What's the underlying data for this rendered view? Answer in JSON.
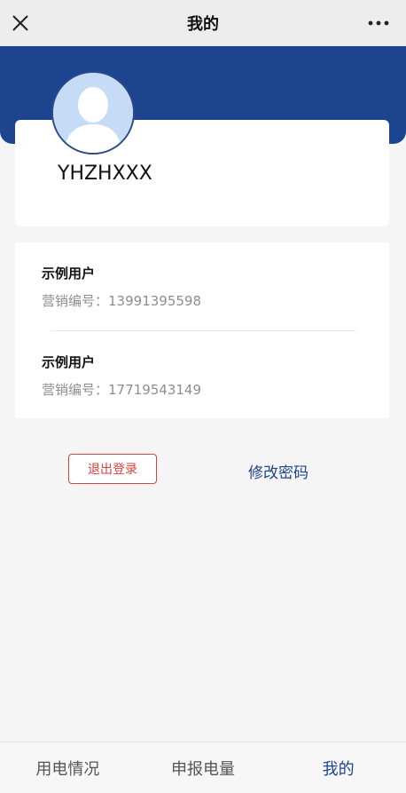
{
  "header": {
    "title": "我的",
    "close_icon": "close-icon",
    "more_icon": "more-icon"
  },
  "profile": {
    "username": "YHZHXXX",
    "avatar_icon": "user-avatar-icon"
  },
  "accounts": [
    {
      "name": "示例用户",
      "number_label": "营销编号：",
      "number": "13991395598"
    },
    {
      "name": "示例用户",
      "number_label": "营销编号：",
      "number": "17719543149"
    }
  ],
  "actions": {
    "logout_label": "退出登录",
    "change_password_label": "修改密码"
  },
  "tabs": [
    {
      "label": "用电情况",
      "active": false
    },
    {
      "label": "申报电量",
      "active": false
    },
    {
      "label": "我的",
      "active": true
    }
  ],
  "colors": {
    "brand": "#1c448f",
    "logout": "#d9423d"
  }
}
